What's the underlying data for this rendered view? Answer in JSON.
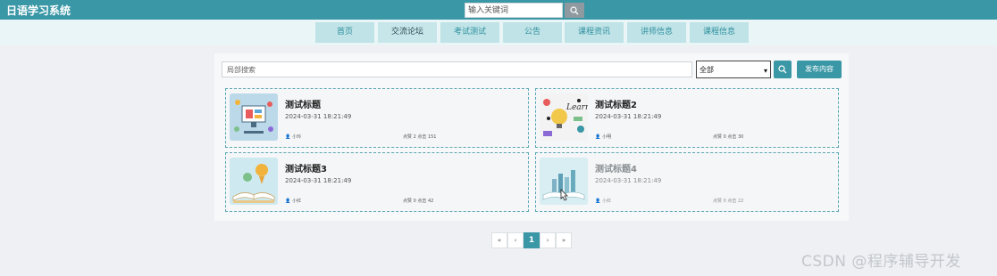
{
  "brand": {
    "title": "日语学习系统"
  },
  "header": {
    "search_placeholder": "输入关键词"
  },
  "nav": {
    "items": [
      {
        "label": "首页"
      },
      {
        "label": "交流论坛"
      },
      {
        "label": "考试测试"
      },
      {
        "label": "公告"
      },
      {
        "label": "课程资讯"
      },
      {
        "label": "讲师信息"
      },
      {
        "label": "课程信息"
      }
    ]
  },
  "toolbar": {
    "search_placeholder": "局部搜索",
    "filter_value": "全部",
    "publish_label": "发布内容"
  },
  "posts": [
    {
      "title": "测试标题",
      "date": "2024-03-31 18:21:49",
      "author": "小玲",
      "stats": "点赞 2 点击 151"
    },
    {
      "title": "测试标题2",
      "date": "2024-03-31 18:21:49",
      "author": "小明",
      "stats": "点赞 0 点击 30"
    },
    {
      "title": "测试标题3",
      "date": "2024-03-31 18:21:49",
      "author": "小红",
      "stats": "点赞 0 点击 42"
    },
    {
      "title": "测试标题4",
      "date": "2024-03-31 18:21:49",
      "author": "小红",
      "stats": "点赞 0 点击 22"
    }
  ],
  "pagination": {
    "first": "«",
    "prev": "‹",
    "current": "1",
    "next": "›",
    "last": "»"
  },
  "watermark": "CSDN @程序辅导开发",
  "colors": {
    "accent": "#3a97a6",
    "nav_bg": "#bfe3e7",
    "page_bg": "#eef0f3"
  }
}
